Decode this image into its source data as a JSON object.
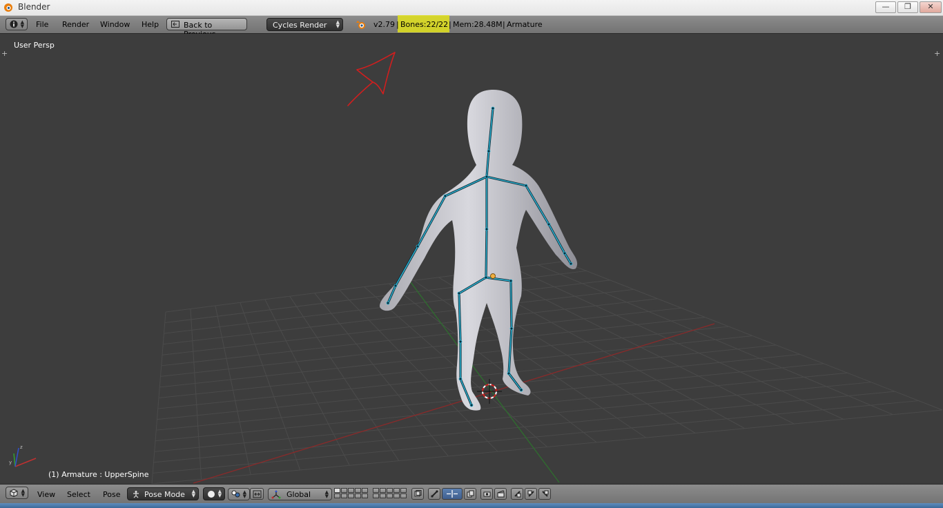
{
  "window": {
    "title": "Blender",
    "controls": {
      "minimize": "—",
      "restore": "❐",
      "close": "✕"
    }
  },
  "info_header": {
    "editor_type_icon": "info-icon",
    "menus": [
      "File",
      "Render",
      "Window",
      "Help"
    ],
    "back_button_label": "Back to Previous",
    "render_engine": "Cycles Render",
    "version": "v2.79",
    "bones": "Bones:22/22",
    "memory": "Mem:28.48M",
    "active_object": "Armature",
    "separator": "|"
  },
  "viewport": {
    "view_label": "User Persp",
    "status_label": "(1) Armature : UpperSpine",
    "colors": {
      "background": "#3d3d3d",
      "grid": "#4b4b4b",
      "x_axis": "#8a2a2a",
      "y_axis": "#2e6e2e",
      "mesh": "#c9c9cf",
      "bones": "#2fb8d8",
      "annotation": "#d21e1e"
    }
  },
  "bottom_header": {
    "editor_type_icon": "cube-icon",
    "menus": [
      "View",
      "Select",
      "Pose"
    ],
    "mode": "Pose Mode",
    "shading_icon": "sphere-icon",
    "pivot_icon": "pivot-icon",
    "manipulator_icon": "manipulator-icon",
    "orientation": "Global"
  },
  "colors": {
    "header_bg": "#808080",
    "highlight": "#e2e21c"
  }
}
